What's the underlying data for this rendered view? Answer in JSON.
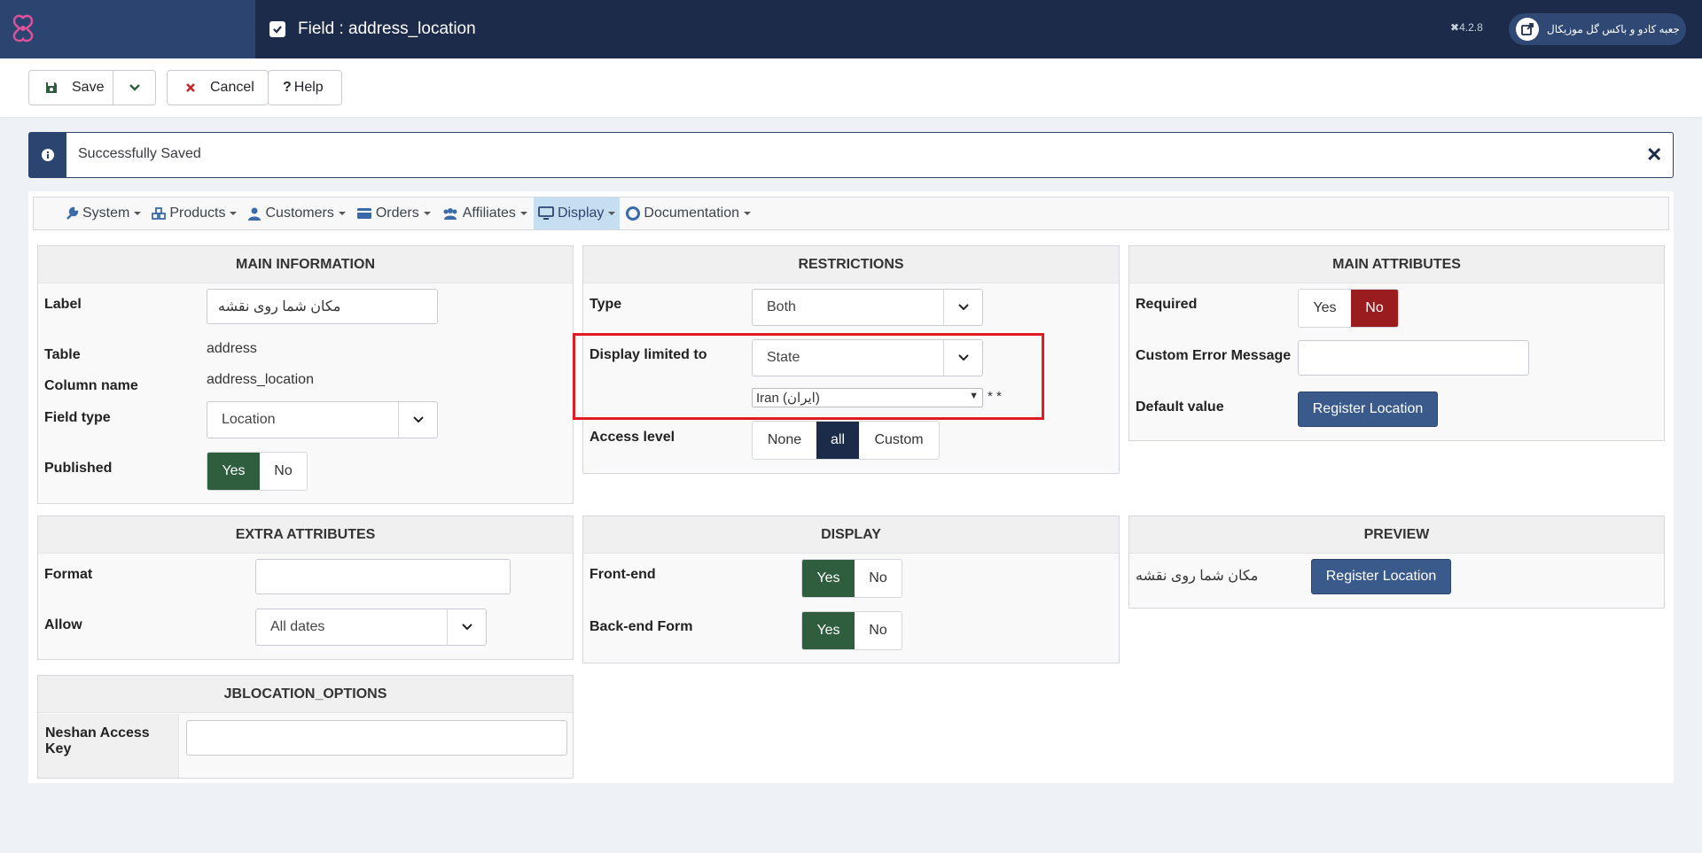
{
  "header": {
    "title": "Field : address_location",
    "version": "4.2.8",
    "site_name": "جعبه کادو و باکس گل موزیکال"
  },
  "toolbar": {
    "save_label": "Save",
    "cancel_label": "Cancel",
    "help_label": "Help"
  },
  "alert": {
    "message": "Successfully Saved"
  },
  "menu": {
    "items": [
      {
        "label": "System",
        "icon": "wrench-icon"
      },
      {
        "label": "Products",
        "icon": "cubes-icon"
      },
      {
        "label": "Customers",
        "icon": "user-icon"
      },
      {
        "label": "Orders",
        "icon": "credit-card-icon"
      },
      {
        "label": "Affiliates",
        "icon": "users-icon"
      },
      {
        "label": "Display",
        "icon": "desktop-icon",
        "active": true
      },
      {
        "label": "Documentation",
        "icon": "life-ring-icon"
      }
    ]
  },
  "main_info": {
    "heading": "MAIN INFORMATION",
    "label_label": "Label",
    "label_value": "مکان شما روی نقشه",
    "table_label": "Table",
    "table_value": "address",
    "column_label": "Column name",
    "column_value": "address_location",
    "field_type_label": "Field type",
    "field_type_value": "Location",
    "published_label": "Published",
    "yes": "Yes",
    "no": "No"
  },
  "restrictions": {
    "heading": "RESTRICTIONS",
    "type_label": "Type",
    "type_value": "Both",
    "display_limited_label": "Display limited to",
    "display_limited_value": "State",
    "country_value": "Iran (ایران)",
    "stars": "* *",
    "access_label": "Access level",
    "access_none": "None",
    "access_all": "all",
    "access_custom": "Custom"
  },
  "main_attributes": {
    "heading": "MAIN ATTRIBUTES",
    "required_label": "Required",
    "yes": "Yes",
    "no": "No",
    "custom_error_label": "Custom Error Message",
    "custom_error_value": "",
    "default_label": "Default value",
    "register_button": "Register Location"
  },
  "extra_attributes": {
    "heading": "EXTRA ATTRIBUTES",
    "format_label": "Format",
    "format_value": "",
    "allow_label": "Allow",
    "allow_value": "All dates"
  },
  "display": {
    "heading": "DISPLAY",
    "frontend_label": "Front-end",
    "backend_label": "Back-end Form",
    "yes": "Yes",
    "no": "No"
  },
  "preview": {
    "heading": "PREVIEW",
    "label": "مکان شما روی نقشه",
    "register_button": "Register Location"
  },
  "jblocation": {
    "heading": "JBLOCATION_OPTIONS",
    "access_key_label": "Neshan Access Key",
    "access_key_value": ""
  },
  "colors": {
    "navy": "#1c2b4a",
    "green": "#2e5e3e",
    "red": "#9a1c1f",
    "highlight": "#e01b24"
  }
}
